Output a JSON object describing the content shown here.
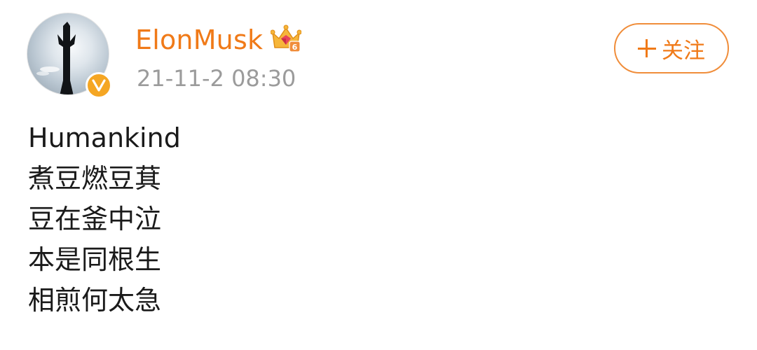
{
  "author": {
    "name": "ElonMusk",
    "avatar_icon": "avatar-rocket-silhouette",
    "verified_icon": "verified-v-badge",
    "rank_icon": "vip-crown-icon",
    "rank_level": "6",
    "timestamp": "21-11-2 08:30"
  },
  "actions": {
    "follow_label": "关注",
    "follow_icon": "plus-icon"
  },
  "post": {
    "lines": [
      "Humankind",
      "煮豆燃豆萁",
      "豆在釜中泣",
      "本是同根生",
      "相煎何太急"
    ]
  },
  "colors": {
    "accent": "#f07a18",
    "verified": "#f5a623",
    "timestamp": "#9b9b9b",
    "text": "#1a1a1a"
  }
}
